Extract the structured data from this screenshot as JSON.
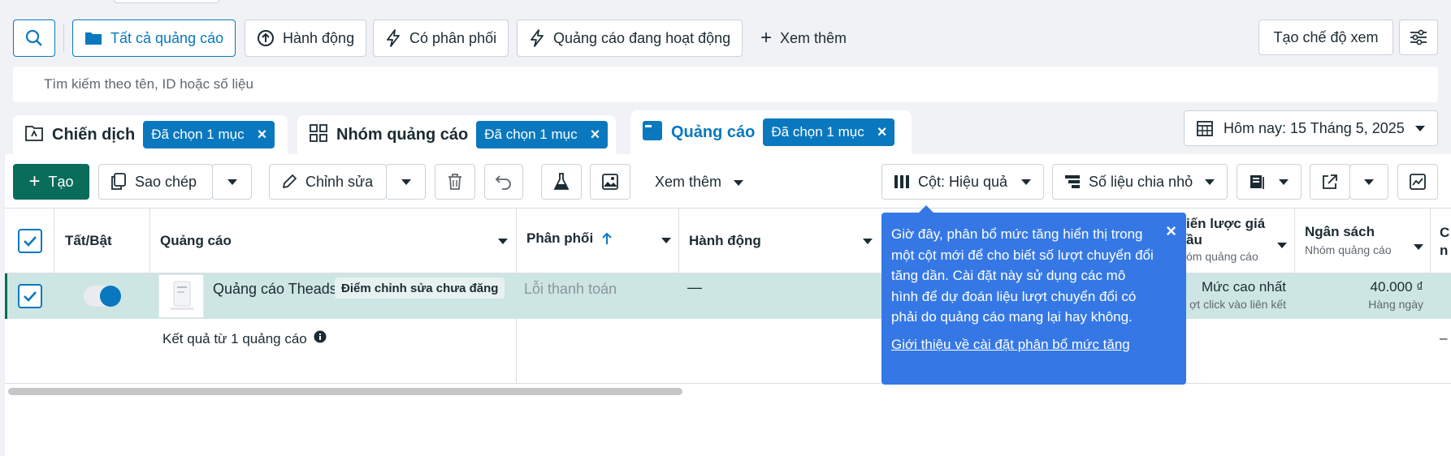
{
  "filters": {
    "all_ads": "Tất cả quảng cáo",
    "actions": "Hành động",
    "delivery": "Có phân phối",
    "active_ads": "Quảng cáo đang hoạt động",
    "see_more": "Xem thêm",
    "create_view": "Tạo chế độ xem"
  },
  "search": {
    "placeholder": "Tìm kiếm theo tên, ID hoặc số liệu"
  },
  "tabs": {
    "campaigns": {
      "label": "Chiến dịch",
      "chip": "Đã chọn 1 mục"
    },
    "adsets": {
      "label": "Nhóm quảng cáo",
      "chip": "Đã chọn 1 mục"
    },
    "ads": {
      "label": "Quảng cáo",
      "chip": "Đã chọn 1 mục"
    }
  },
  "date_range": "Hôm nay: 15 Tháng 5, 2025",
  "toolbar": {
    "create": "Tạo",
    "duplicate": "Sao chép",
    "edit": "Chỉnh sửa",
    "more": "Xem thêm",
    "columns": "Cột: Hiệu quả",
    "breakdown": "Số liệu chia nhỏ"
  },
  "table": {
    "headers": {
      "toggle": "Tất/Bật",
      "ad": "Quảng cáo",
      "delivery": "Phân phối",
      "actions": "Hành động",
      "bid_strategy_partial": "iến lược giá",
      "bid_strategy_partial2": "ầu",
      "bid_strategy_sub": "óm quảng cáo",
      "budget": "Ngân sách",
      "budget_sub": "Nhóm quảng cáo",
      "cut_col_top": "C",
      "cut_col_bottom": "n"
    },
    "row": {
      "name": "Quảng cáo Theads",
      "badge": "Điểm chỉnh sửa chưa đăng",
      "delivery": "Lỗi thanh toán",
      "actions": "—",
      "bid_strategy": "Mức cao nhất",
      "bid_strategy_sub": "ợt click vào liên kết",
      "budget": "40.000 ₫",
      "budget_sub": "Hàng ngày"
    },
    "summary": "Kết quả từ 1 quảng cáo",
    "summary_dash": "–"
  },
  "tooltip": {
    "text": "Giờ đây, phân bổ mức tăng hiển thị trong một cột mới để cho biết số lượt chuyển đổi tăng dần. Cài đặt này sử dụng các mô hình để dự đoán liệu lượt chuyển đổi có phải do quảng cáo mang lại hay không.",
    "link": "Giới thiệu về cài đặt phân bổ mức tăng"
  },
  "colors": {
    "accent_blue": "#0a78be",
    "create_green": "#0a6c5a",
    "tooltip_blue": "#3578e5",
    "row_selected": "#cde6e3"
  }
}
